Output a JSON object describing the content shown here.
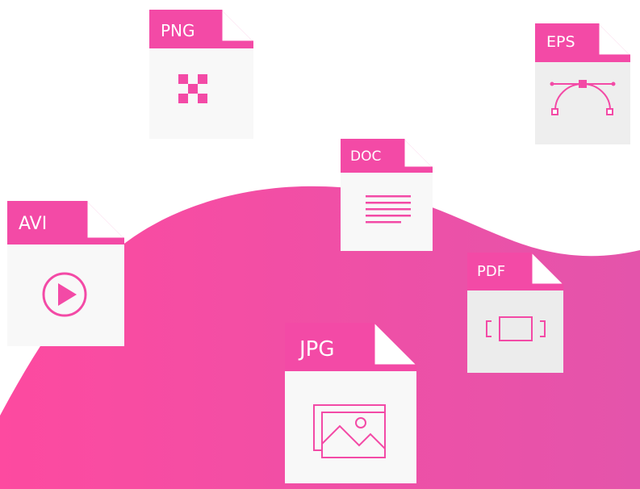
{
  "files": [
    {
      "key": "png",
      "label": "PNG",
      "icon": "checker-icon"
    },
    {
      "key": "eps",
      "label": "EPS",
      "icon": "bezier-curve-icon"
    },
    {
      "key": "doc",
      "label": "DOC",
      "icon": "text-lines-icon"
    },
    {
      "key": "avi",
      "label": "AVI",
      "icon": "play-icon"
    },
    {
      "key": "pdf",
      "label": "PDF",
      "icon": "frame-icon"
    },
    {
      "key": "jpg",
      "label": "JPG",
      "icon": "image-icon"
    }
  ],
  "colors": {
    "accent": "#f34aa6",
    "wave_left": "#fd4aa0",
    "wave_right": "#e755a9",
    "page_light": "#f8f8f8",
    "page_grey": "#ececec"
  }
}
